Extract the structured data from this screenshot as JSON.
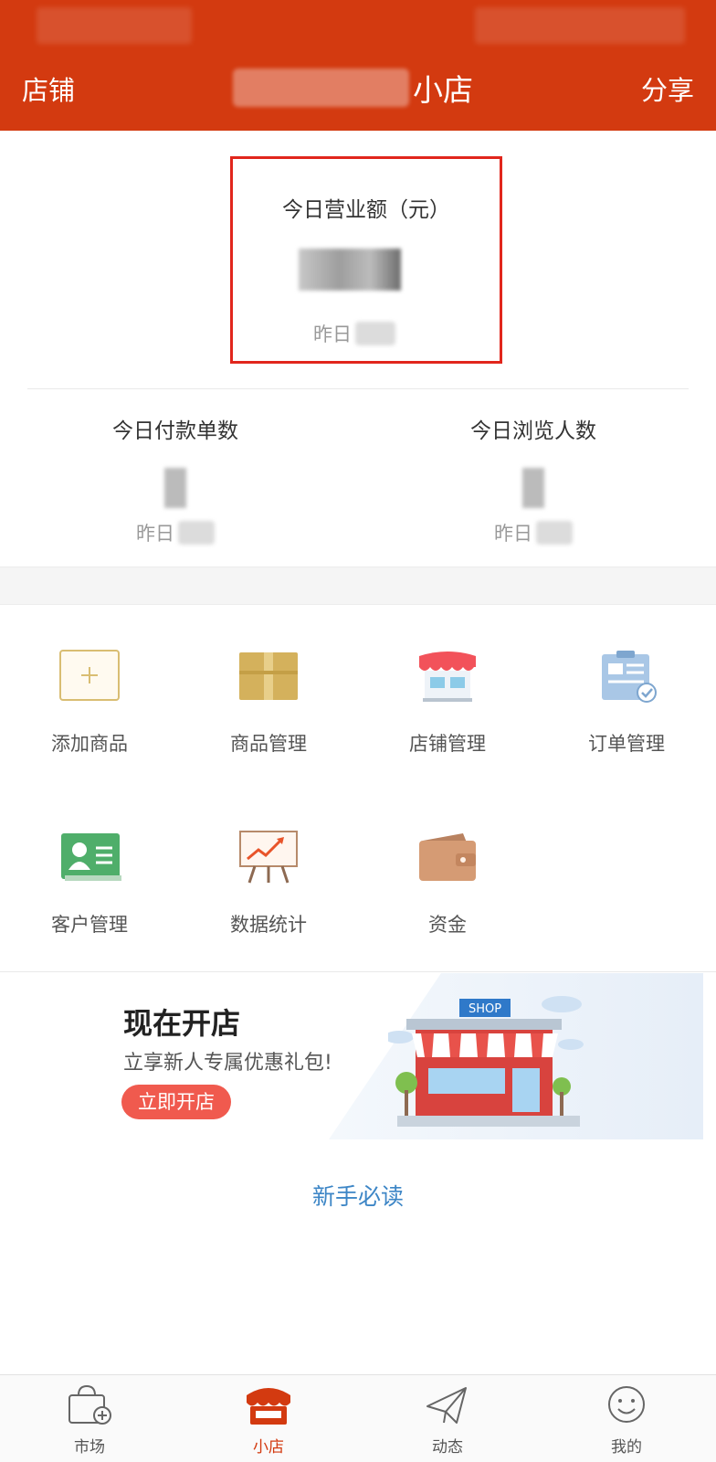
{
  "header": {
    "left_label": "店铺",
    "title": "小店",
    "right_label": "分享"
  },
  "revenue": {
    "label": "今日营业额（元）",
    "yesterday_label": "昨日"
  },
  "stats": [
    {
      "label": "今日付款单数",
      "yesterday_label": "昨日"
    },
    {
      "label": "今日浏览人数",
      "yesterday_label": "昨日"
    }
  ],
  "grid": {
    "items": [
      {
        "label": "添加商品",
        "icon": "add-product-icon"
      },
      {
        "label": "商品管理",
        "icon": "box-icon"
      },
      {
        "label": "店铺管理",
        "icon": "storefront-icon"
      },
      {
        "label": "订单管理",
        "icon": "clipboard-check-icon"
      },
      {
        "label": "客户管理",
        "icon": "contact-card-icon"
      },
      {
        "label": "数据统计",
        "icon": "chart-board-icon"
      },
      {
        "label": "资金",
        "icon": "wallet-icon"
      }
    ]
  },
  "banner": {
    "title": "现在开店",
    "subtitle": "立享新人专属优惠礼包!",
    "cta": "立即开店",
    "shop_sign": "SHOP"
  },
  "guide_link": "新手必读",
  "tabbar": {
    "items": [
      {
        "label": "市场",
        "icon": "market-bag-icon",
        "active": false
      },
      {
        "label": "小店",
        "icon": "shop-icon",
        "active": true
      },
      {
        "label": "动态",
        "icon": "paper-plane-icon",
        "active": false
      },
      {
        "label": "我的",
        "icon": "smiley-icon",
        "active": false
      }
    ]
  },
  "colors": {
    "brand": "#d33a10",
    "highlight_border": "#e1261c",
    "link": "#3d86c6",
    "cta": "#f05a4e"
  }
}
